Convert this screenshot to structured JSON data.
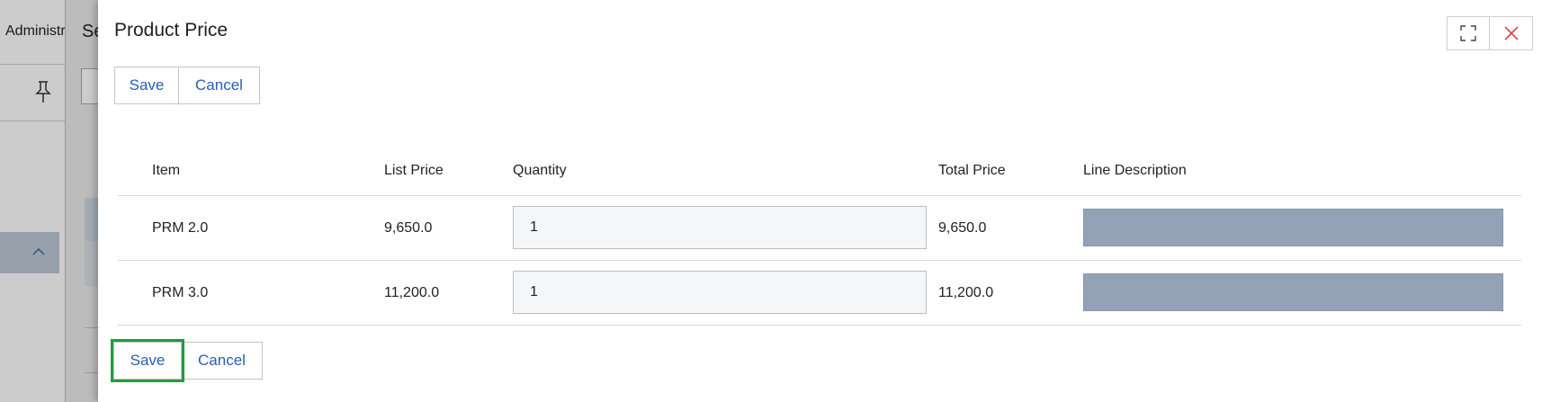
{
  "background": {
    "admin_label": "Administr",
    "se_label": "Se"
  },
  "modal": {
    "title": "Product Price",
    "top_actions": {
      "save": "Save",
      "cancel": "Cancel"
    },
    "bottom_actions": {
      "save": "Save",
      "cancel": "Cancel"
    }
  },
  "table": {
    "headers": {
      "item": "Item",
      "list_price": "List Price",
      "quantity": "Quantity",
      "total_price": "Total Price",
      "line_description": "Line Description"
    },
    "rows": [
      {
        "item": "PRM 2.0",
        "list_price": "9,650.0",
        "quantity": "1",
        "total_price": "9,650.0",
        "line_description": ""
      },
      {
        "item": "PRM 3.0",
        "list_price": "11,200.0",
        "quantity": "1",
        "total_price": "11,200.0",
        "line_description": ""
      }
    ]
  },
  "colors": {
    "accent_link": "#2a5db0",
    "focus_outline": "#1f9e3d",
    "close_icon": "#d24a4a",
    "description_fill": "#93a2b6"
  },
  "icons": {
    "pin": "pin-icon",
    "collapse": "chevron-up-icon",
    "maximize": "maximize-icon",
    "close": "close-icon"
  }
}
